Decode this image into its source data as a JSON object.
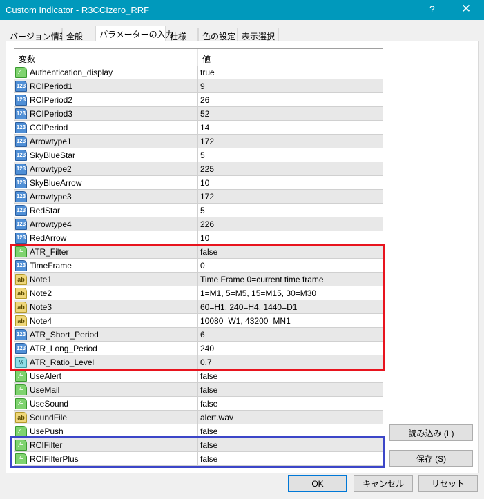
{
  "window": {
    "title": "Custom Indicator - R3CCIzero_RRF",
    "help_label": "?",
    "close_label": "✕"
  },
  "tabs": [
    {
      "label": "バージョン情報"
    },
    {
      "label": "全般"
    },
    {
      "label": "パラメーターの入力",
      "active": true
    },
    {
      "label": "仕様"
    },
    {
      "label": "色の設定"
    },
    {
      "label": "表示選択"
    }
  ],
  "table": {
    "headers": {
      "variable": "変数",
      "value": "値"
    },
    "rows": [
      {
        "type": "bool",
        "name": "Authentication_display",
        "value": "true"
      },
      {
        "type": "int",
        "name": "RCIPeriod1",
        "value": "9"
      },
      {
        "type": "int",
        "name": "RCIPeriod2",
        "value": "26"
      },
      {
        "type": "int",
        "name": "RCIPeriod3",
        "value": "52"
      },
      {
        "type": "int",
        "name": "CCIPeriod",
        "value": "14"
      },
      {
        "type": "int",
        "name": "Arrowtype1",
        "value": "172"
      },
      {
        "type": "int",
        "name": "SkyBlueStar",
        "value": "5"
      },
      {
        "type": "int",
        "name": "Arrowtype2",
        "value": "225"
      },
      {
        "type": "int",
        "name": "SkyBlueArrow",
        "value": "10"
      },
      {
        "type": "int",
        "name": "Arrowtype3",
        "value": "172"
      },
      {
        "type": "int",
        "name": "RedStar",
        "value": "5"
      },
      {
        "type": "int",
        "name": "Arrowtype4",
        "value": "226"
      },
      {
        "type": "int",
        "name": "RedArrow",
        "value": "10"
      },
      {
        "type": "bool",
        "name": "ATR_Filter",
        "value": "false"
      },
      {
        "type": "int",
        "name": "TimeFrame",
        "value": "0"
      },
      {
        "type": "string",
        "name": "Note1",
        "value": "Time Frame 0=current time frame"
      },
      {
        "type": "string",
        "name": "Note2",
        "value": "1=M1, 5=M5, 15=M15, 30=M30"
      },
      {
        "type": "string",
        "name": "Note3",
        "value": "60=H1, 240=H4, 1440=D1"
      },
      {
        "type": "string",
        "name": "Note4",
        "value": "10080=W1, 43200=MN1"
      },
      {
        "type": "int",
        "name": "ATR_Short_Period",
        "value": "6"
      },
      {
        "type": "int",
        "name": "ATR_Long_Period",
        "value": "240"
      },
      {
        "type": "double",
        "name": "ATR_Ratio_Level",
        "value": "0.7"
      },
      {
        "type": "bool",
        "name": "UseAlert",
        "value": "false"
      },
      {
        "type": "bool",
        "name": "UseMail",
        "value": "false"
      },
      {
        "type": "bool",
        "name": "UseSound",
        "value": "false"
      },
      {
        "type": "string",
        "name": "SoundFile",
        "value": "alert.wav"
      },
      {
        "type": "bool",
        "name": "UsePush",
        "value": "false"
      },
      {
        "type": "bool",
        "name": "RCIFilter",
        "value": "false"
      },
      {
        "type": "bool",
        "name": "RCIFilterPlus",
        "value": "false"
      }
    ]
  },
  "icon_glyphs": {
    "bool": "⁄–",
    "int": "123",
    "string": "ab",
    "double": "½"
  },
  "highlights": {
    "red": "#e8141e",
    "blue": "#3c46c8"
  },
  "buttons": {
    "load": "読み込み (L)",
    "save": "保存 (S)",
    "ok": "OK",
    "cancel": "キャンセル",
    "reset": "リセット"
  }
}
